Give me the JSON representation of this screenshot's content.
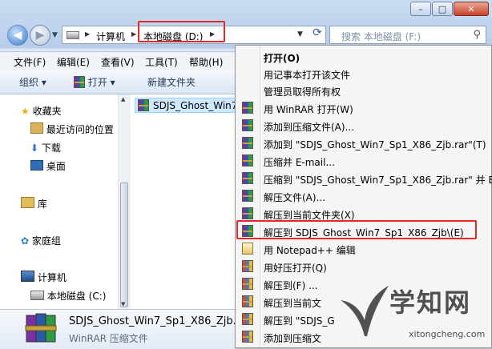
{
  "window": {
    "caption_buttons": [
      "minimize",
      "maximize",
      "close"
    ]
  },
  "address": {
    "segments": [
      "计算机",
      "本地磁盘 (D:)"
    ]
  },
  "search": {
    "placeholder": "搜索 本地磁盘 (F:)"
  },
  "menubar": [
    "文件(F)",
    "编辑(E)",
    "查看(V)",
    "工具(T)",
    "帮助(H)"
  ],
  "toolbar": {
    "organize": "组织 ▾",
    "open": "打开 ▾",
    "new_folder": "新建文件夹"
  },
  "nav": {
    "favorites": "收藏夹",
    "recent": "最近访问的位置",
    "downloads": "下载",
    "desktop": "桌面",
    "libraries": "库",
    "homegroup": "家庭组",
    "computer": "计算机",
    "local_disk_c": "本地磁盘 (C:)"
  },
  "file": {
    "name": "SDJS_Ghost_Win7_"
  },
  "details": {
    "name": "SDJS_Ghost_Win7_Sp1_X86_Zjb.is",
    "type": "WinRAR 压缩文件"
  },
  "context_menu": [
    {
      "label": "打开(O)",
      "icon": "none",
      "bold": true
    },
    {
      "label": "用记事本打开该文件",
      "icon": "none"
    },
    {
      "label": "管理员取得所有权",
      "icon": "none"
    },
    {
      "label": "用 WinRAR 打开(W)",
      "icon": "winrar-icon"
    },
    {
      "label": "添加到压缩文件(A)...",
      "icon": "winrar-icon"
    },
    {
      "label": "添加到 \"SDJS_Ghost_Win7_Sp1_X86_Zjb.rar\"(T)",
      "icon": "winrar-icon"
    },
    {
      "label": "压缩并 E-mail...",
      "icon": "winrar-icon"
    },
    {
      "label": "压缩到 \"SDJS_Ghost_Win7_Sp1_X86_Zjb.rar\" 并 E-m",
      "icon": "winrar-icon"
    },
    {
      "label": "解压文件(A)...",
      "icon": "winrar-icon"
    },
    {
      "label": "解压到当前文件夹(X)",
      "icon": "winrar-icon"
    },
    {
      "label": "解压到 SDJS_Ghost_Win7_Sp1_X86_Zjb\\(E)",
      "icon": "winrar-icon"
    },
    {
      "label": "用 Notepad++ 编辑",
      "icon": "notepad-icon"
    },
    {
      "label": "用好压打开(Q)",
      "icon": "haozip-icon"
    },
    {
      "label": "解压到(F) ...",
      "icon": "haozip-icon"
    },
    {
      "label": "解压到当前文",
      "icon": "haozip-icon"
    },
    {
      "label": "解压到 \"SDJS_G",
      "icon": "haozip-icon"
    },
    {
      "label": "添加到压缩文",
      "icon": "haozip-icon"
    }
  ],
  "watermark": {
    "brand": "学知网",
    "url": "xitongcheng.com"
  }
}
